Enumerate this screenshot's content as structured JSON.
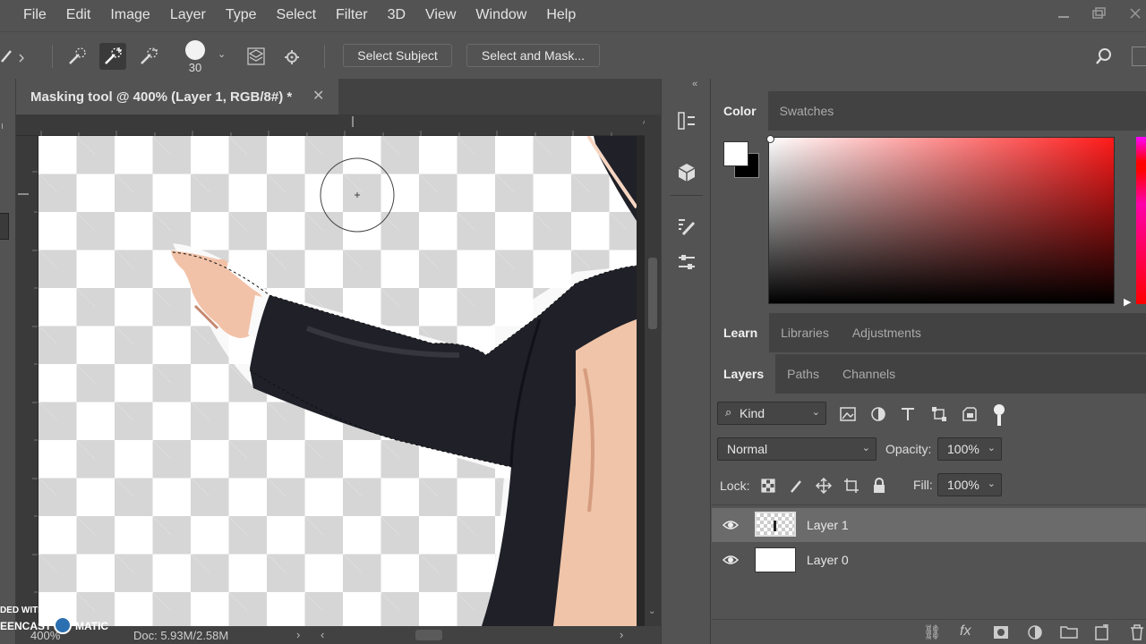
{
  "menu": [
    "File",
    "Edit",
    "Image",
    "Layer",
    "Type",
    "Select",
    "Filter",
    "3D",
    "View",
    "Window",
    "Help"
  ],
  "options": {
    "brush_size": "30",
    "select_subject": "Select Subject",
    "select_and_mask": "Select and Mask..."
  },
  "document": {
    "tab_title": "Masking tool @ 400% (Layer 1, RGB/8#) *",
    "zoom": "400%",
    "doc_info": "Doc: 5.93M/2.58M"
  },
  "color_panel": {
    "tabs": [
      "Color",
      "Swatches"
    ],
    "foreground": "#ffffff",
    "background": "#000000"
  },
  "learn_tabs": [
    "Learn",
    "Libraries",
    "Adjustments"
  ],
  "layers_panel": {
    "tabs": [
      "Layers",
      "Paths",
      "Channels"
    ],
    "kind_label": "Kind",
    "blend_mode": "Normal",
    "opacity_label": "Opacity:",
    "opacity": "100%",
    "lock_label": "Lock:",
    "fill_label": "Fill:",
    "fill": "100%",
    "layers": [
      {
        "name": "Layer 1",
        "selected": true
      },
      {
        "name": "Layer 0",
        "selected": false
      }
    ]
  },
  "watermark": {
    "line1": "DED WITH",
    "line2": "EENCAST",
    "line3": "MATIC"
  }
}
